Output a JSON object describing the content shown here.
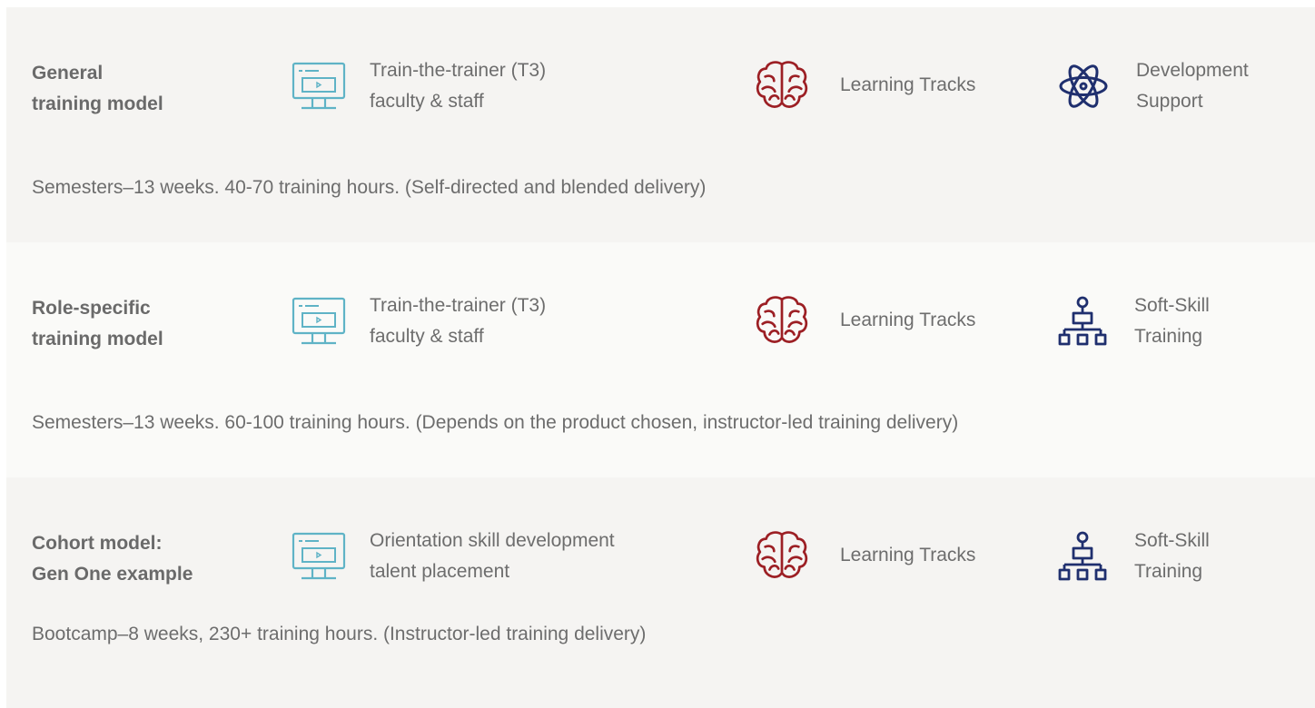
{
  "colors": {
    "panel_bg": "#f5f4f2",
    "panel_bg_alt": "#fafaf8",
    "text": "#6d6d6d",
    "monitor_icon": "#5fb3c6",
    "brain_icon": "#9c1f24",
    "navy_icon": "#1f2f6e"
  },
  "models": [
    {
      "title_line1": "General",
      "title_line2": "training model",
      "feature1": {
        "icon": "monitor-icon",
        "line1": "Train-the-trainer (T3)",
        "line2": "faculty & staff"
      },
      "feature2": {
        "icon": "brain-icon",
        "line1": "Learning Tracks"
      },
      "feature3": {
        "icon": "atom-icon",
        "line1": "Development",
        "line2": "Support"
      },
      "description": "Semesters–13 weeks. 40-70 training hours. (Self-directed and blended delivery)"
    },
    {
      "title_line1": "Role-specific",
      "title_line2": "training model",
      "feature1": {
        "icon": "monitor-icon",
        "line1": "Train-the-trainer (T3)",
        "line2": "faculty & staff"
      },
      "feature2": {
        "icon": "brain-icon",
        "line1": "Learning Tracks"
      },
      "feature3": {
        "icon": "org-chart-icon",
        "line1": "Soft-Skill",
        "line2": "Training"
      },
      "description": "Semesters–13 weeks. 60-100 training hours. (Depends on the product chosen, instructor-led training delivery)"
    },
    {
      "title_line1": "Cohort model:",
      "title_line2": "Gen One example",
      "feature1": {
        "icon": "monitor-icon",
        "line1": "Orientation skill development",
        "line2": "talent placement"
      },
      "feature2": {
        "icon": "brain-icon",
        "line1": "Learning Tracks"
      },
      "feature3": {
        "icon": "org-chart-icon",
        "line1": "Soft-Skill",
        "line2": "Training"
      },
      "description": "Bootcamp–8 weeks, 230+ training hours. (Instructor-led training delivery)"
    }
  ]
}
